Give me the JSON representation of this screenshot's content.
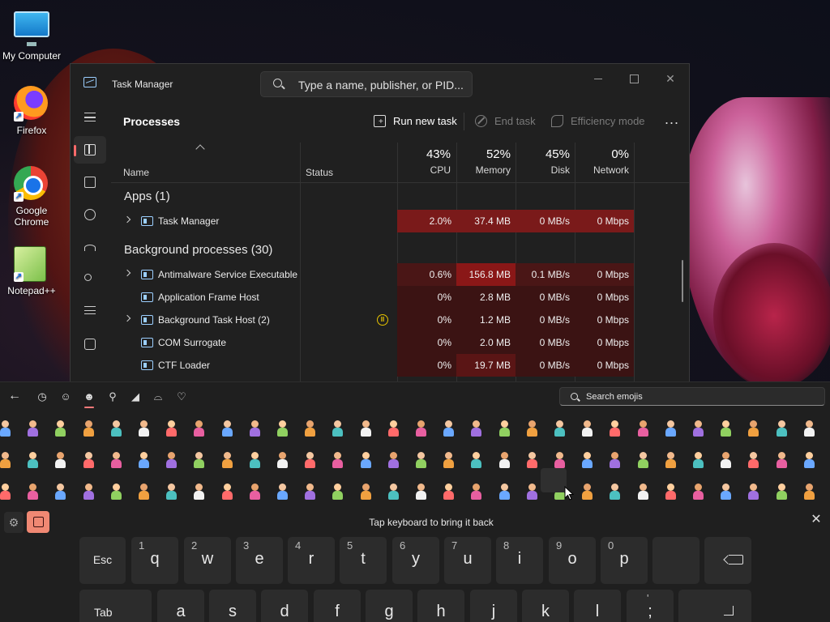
{
  "desktop": {
    "icons": [
      {
        "label": "My Computer",
        "icon": "computer-icon"
      },
      {
        "label": "Firefox",
        "icon": "firefox-icon"
      },
      {
        "label": "Google Chrome",
        "icon": "chrome-icon"
      },
      {
        "label": "Notepad++",
        "icon": "notepadpp-icon"
      }
    ]
  },
  "task_manager": {
    "title": "Task Manager",
    "search_placeholder": "Type a name, publisher, or PID...",
    "page_title": "Processes",
    "toolbar": {
      "run_new_task": "Run new task",
      "end_task": "End task",
      "efficiency_mode": "Efficiency mode",
      "more": "..."
    },
    "columns": {
      "name": "Name",
      "status": "Status",
      "cpu": {
        "pct": "43%",
        "label": "CPU"
      },
      "memory": {
        "pct": "52%",
        "label": "Memory"
      },
      "disk": {
        "pct": "45%",
        "label": "Disk"
      },
      "network": {
        "pct": "0%",
        "label": "Network"
      }
    },
    "groups": {
      "apps": "Apps (1)",
      "background": "Background processes (30)"
    },
    "apps": [
      {
        "name": "Task Manager",
        "expandable": true,
        "cpu": "2.0%",
        "memory": "37.4 MB",
        "disk": "0 MB/s",
        "network": "0 Mbps"
      }
    ],
    "background": [
      {
        "name": "Antimalware Service Executable",
        "expandable": true,
        "cpu": "0.6%",
        "memory": "156.8 MB",
        "disk": "0.1 MB/s",
        "network": "0 Mbps"
      },
      {
        "name": "Application Frame Host",
        "expandable": false,
        "cpu": "0%",
        "memory": "2.8 MB",
        "disk": "0 MB/s",
        "network": "0 Mbps"
      },
      {
        "name": "Background Task Host (2)",
        "expandable": true,
        "status": "paused-icon",
        "cpu": "0%",
        "memory": "1.2 MB",
        "disk": "0 MB/s",
        "network": "0 Mbps"
      },
      {
        "name": "COM Surrogate",
        "expandable": false,
        "cpu": "0%",
        "memory": "2.0 MB",
        "disk": "0 MB/s",
        "network": "0 Mbps"
      },
      {
        "name": "CTF Loader",
        "expandable": false,
        "cpu": "0%",
        "memory": "19.7 MB",
        "disk": "0 MB/s",
        "network": "0 Mbps"
      }
    ],
    "sidebar": [
      "menu-icon",
      "processes-icon",
      "performance-icon",
      "app-history-icon",
      "startup-apps-icon",
      "users-icon",
      "details-icon",
      "services-icon"
    ]
  },
  "keyboard": {
    "emoji_search_placeholder": "Search emojis",
    "categories": [
      "back-arrow-icon",
      "recent-icon",
      "smiley-icon",
      "people-icon",
      "location-icon",
      "vehicle-icon",
      "objects-icon",
      "heart-icon"
    ],
    "tap_message": "Tap keyboard to bring it back",
    "row1": [
      {
        "main": "Esc",
        "alt": ""
      },
      {
        "main": "q",
        "alt": "1"
      },
      {
        "main": "w",
        "alt": "2"
      },
      {
        "main": "e",
        "alt": "3"
      },
      {
        "main": "r",
        "alt": "4"
      },
      {
        "main": "t",
        "alt": "5"
      },
      {
        "main": "y",
        "alt": "6"
      },
      {
        "main": "u",
        "alt": "7"
      },
      {
        "main": "i",
        "alt": "8"
      },
      {
        "main": "o",
        "alt": "9"
      },
      {
        "main": "p",
        "alt": "0"
      }
    ],
    "row2": [
      {
        "main": "Tab",
        "alt": ""
      },
      {
        "main": "a",
        "alt": ""
      },
      {
        "main": "s",
        "alt": ""
      },
      {
        "main": "d",
        "alt": ""
      },
      {
        "main": "f",
        "alt": ""
      },
      {
        "main": "g",
        "alt": ""
      },
      {
        "main": "h",
        "alt": ""
      },
      {
        "main": "j",
        "alt": ""
      },
      {
        "main": "k",
        "alt": ""
      },
      {
        "main": "l",
        "alt": ""
      },
      {
        "main": ";",
        "alt": "'"
      }
    ]
  },
  "colors": {
    "accent": "#ff6a6a",
    "emoji_key": "#f08873",
    "paused_status": "#e6c300"
  }
}
